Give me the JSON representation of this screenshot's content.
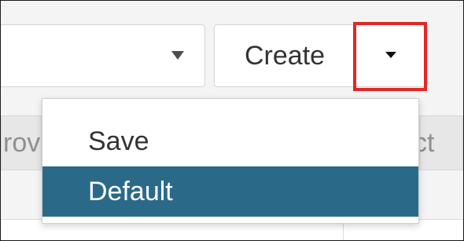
{
  "toolbar": {
    "create_label": "Create"
  },
  "background": {
    "left_fragment": "rov",
    "right_fragment": "ct"
  },
  "dropdown": {
    "items": [
      {
        "label": "Save",
        "selected": false
      },
      {
        "label": "Default",
        "selected": true
      }
    ],
    "highlight_color": "#2a6a88"
  },
  "annotation": {
    "highlight_color": "#e32626"
  },
  "icons": {
    "select_arrow": "triangle-down-icon",
    "split_caret": "caret-down-icon"
  }
}
